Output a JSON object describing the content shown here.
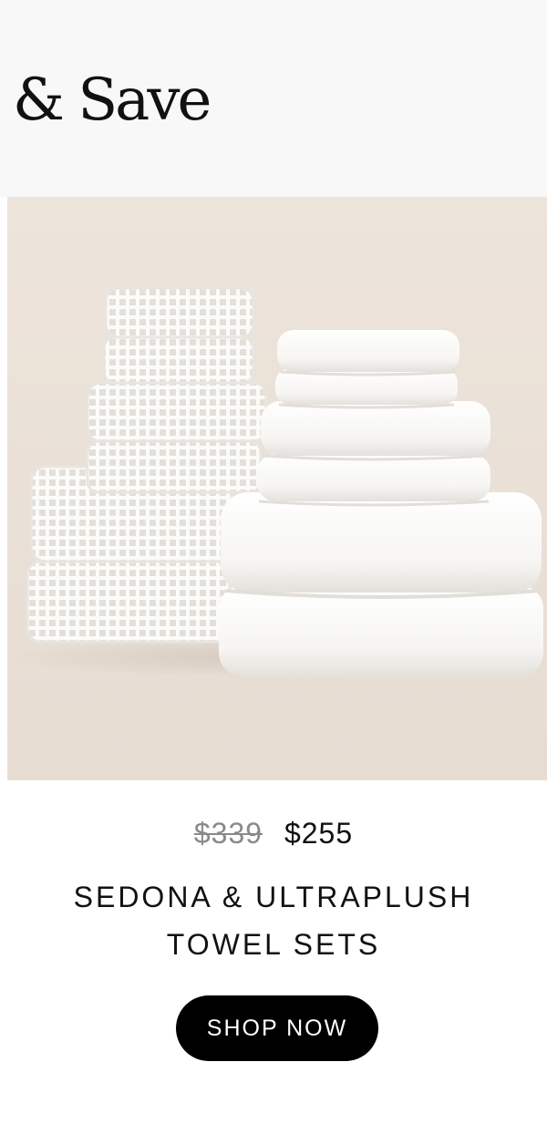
{
  "header": {
    "headline": "& Save"
  },
  "product": {
    "image_alt": "Stacks of white waffle-weave and ultraplush towels",
    "price_original": "$339",
    "price_sale": "$255",
    "title_line1": "SEDONA & ULTRAPLUSH",
    "title_line2": "TOWEL SETS",
    "cta_label": "SHOP NOW"
  },
  "colors": {
    "header_bg": "#f8f8f8",
    "image_bg": "#ece3da",
    "button_bg": "#000000",
    "button_text": "#ffffff",
    "strike_price": "#8a8a8a"
  }
}
